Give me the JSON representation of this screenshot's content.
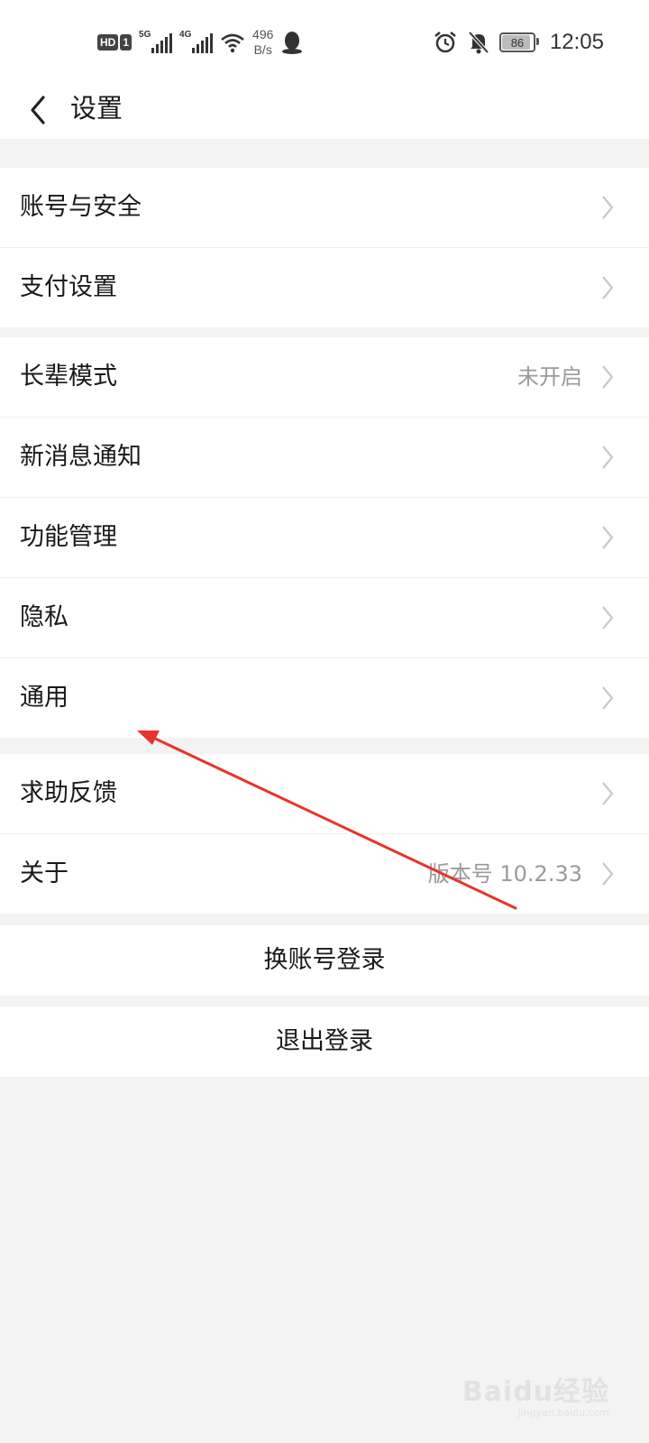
{
  "status_bar": {
    "hd_label": "HD",
    "sim_label": "1",
    "net1": "5G",
    "net2": "4G",
    "speed_value": "496",
    "speed_unit": "B/s",
    "battery": "86",
    "battery_level": 0.86,
    "time": "12:05",
    "icons": [
      "signal-icon",
      "wifi-icon",
      "qq-icon",
      "alarm-icon",
      "mute-icon",
      "battery-icon"
    ]
  },
  "header": {
    "title": "设置"
  },
  "groups": [
    {
      "items": [
        {
          "label": "账号与安全",
          "value": ""
        },
        {
          "label": "支付设置",
          "value": ""
        }
      ]
    },
    {
      "items": [
        {
          "label": "长辈模式",
          "value": "未开启"
        },
        {
          "label": "新消息通知",
          "value": ""
        },
        {
          "label": "功能管理",
          "value": ""
        },
        {
          "label": "隐私",
          "value": ""
        },
        {
          "label": "通用",
          "value": ""
        }
      ]
    },
    {
      "items": [
        {
          "label": "求助反馈",
          "value": ""
        },
        {
          "label": "关于",
          "value": "版本号 10.2.33"
        }
      ]
    }
  ],
  "actions": {
    "switch_account": "换账号登录",
    "logout": "退出登录"
  },
  "annotation": {
    "color": "#e8342a"
  },
  "watermark": {
    "brand": "Baidu经验",
    "sub": "jingyan.baidu.com"
  },
  "colors": {
    "background": "#f3f3f3",
    "surface": "#ffffff",
    "secondary_text": "#9a9a9a"
  }
}
